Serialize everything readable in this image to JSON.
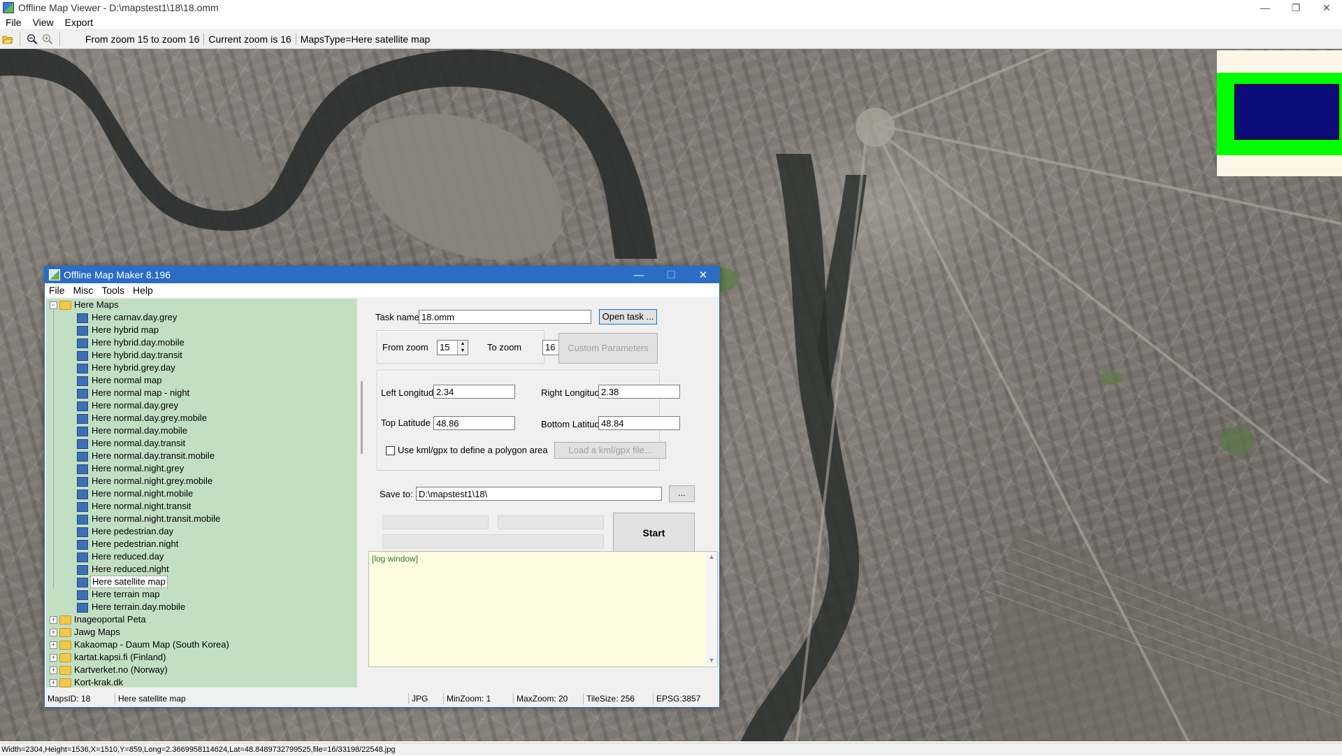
{
  "window": {
    "title": "Offline Map Viewer - D:\\mapstest1\\18\\18.omm",
    "controls": {
      "minimize": "—",
      "maximize": "❐",
      "close": "✕"
    }
  },
  "menu": [
    "File",
    "View",
    "Export"
  ],
  "toolbar": {
    "zoom_range": "From zoom 15 to zoom 16",
    "current_zoom": "Current zoom is 16",
    "maps_type": "MapsType=Here satellite map"
  },
  "status_bar": "Width=2304,Height=1536,X=1510,Y=859,Long=2.3669958114624,Lat=48.8489732799525,file=16/33198/22548.jpg",
  "colors": {
    "overview_bg": "#fdf6e7",
    "overview_green": "#00ff00",
    "overview_blue": "#0b0b7a",
    "dialog_title_bar": "#2b6cc4",
    "tree_bg": "#c2dfc3",
    "log_bg": "#fffde1"
  },
  "dialog": {
    "title": "Offline Map Maker 8.196",
    "controls": {
      "minimize": "—",
      "maximize": "☐",
      "close": "✕"
    },
    "menu": [
      "File",
      "Misc",
      "Tools",
      "Help"
    ],
    "tree": {
      "root": "Here Maps",
      "items": [
        "Here carnav.day.grey",
        "Here hybrid map",
        "Here hybrid.day.mobile",
        "Here hybrid.day.transit",
        "Here hybrid.grey.day",
        "Here normal map",
        "Here normal map - night",
        "Here normal.day.grey",
        "Here normal.day.grey.mobile",
        "Here normal.day.mobile",
        "Here normal.day.transit",
        "Here normal.day.transit.mobile",
        "Here normal.night.grey",
        "Here normal.night.grey.mobile",
        "Here normal.night.mobile",
        "Here normal.night.transit",
        "Here normal.night.transit.mobile",
        "Here pedestrian.day",
        "Here pedestrian.night",
        "Here reduced.day",
        "Here reduced.night",
        "Here satellite map",
        "Here terrain map",
        "Here terrain.day.mobile"
      ],
      "selected": "Here satellite map",
      "folders": [
        "Inageoportal Peta",
        "Jawg Maps",
        "Kakaomap - Daum Map (South Korea)",
        "kartat.kapsi.fi (Finland)",
        "Kartverket.no (Norway)",
        "Kort-krak.dk"
      ]
    },
    "task_name_label": "Task name",
    "task_name_value": "18.omm",
    "open_task_button": "Open task ...",
    "from_zoom_label": "From zoom",
    "from_zoom_value": "15",
    "to_zoom_label": "To zoom",
    "to_zoom_value": "16",
    "custom_params_button": "Custom Parameters",
    "left_lon_label": "Left Longitude",
    "left_lon_value": "2.34",
    "right_lon_label": "Right Longitude",
    "right_lon_value": "2.38",
    "top_lat_label": "Top Latitude",
    "top_lat_value": "48.86",
    "bottom_lat_label": "Bottom Latitude",
    "bottom_lat_value": "48.84",
    "kml_checkbox_label": "Use kml/gpx to define a polygon area",
    "kml_checked": false,
    "load_kml_button": "Load a kml/gpx file...",
    "save_to_label": "Save to:",
    "save_to_value": "D:\\mapstest1\\18\\",
    "browse_button": "...",
    "start_button": "Start",
    "log_text": "[log window]",
    "status": {
      "maps_id": "MapsID: 18",
      "maps_name": "Here satellite map",
      "format": "JPG",
      "min_zoom": "MinZoom: 1",
      "max_zoom": "MaxZoom: 20",
      "tile_size": "TileSize: 256",
      "epsg": "EPSG:3857"
    }
  }
}
